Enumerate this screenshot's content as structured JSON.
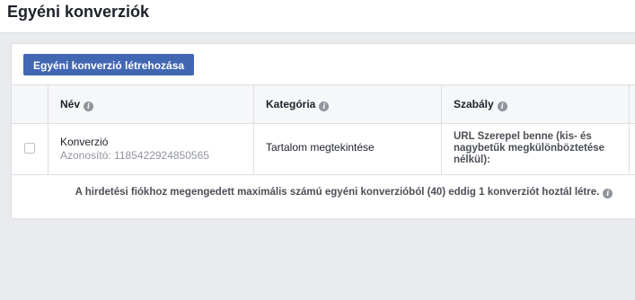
{
  "page": {
    "title": "Egyéni konverziók"
  },
  "toolbar": {
    "create_label": "Egyéni konverzió létrehozása"
  },
  "table": {
    "columns": [
      {
        "label": "Név",
        "info_icon": "info-icon"
      },
      {
        "label": "Kategória",
        "info_icon": "info-icon"
      },
      {
        "label": "Szabály",
        "info_icon": "info-icon"
      }
    ],
    "rows": [
      {
        "name": "Konverzió",
        "id_text": "Azonosító: 1185422924850565",
        "category": "Tartalom megtekintése",
        "rule": "URL Szerepel benne (kis- és nagybetűk megkülönböztetése nélkül):"
      }
    ]
  },
  "footer": {
    "limit_text": "A hirdetési fiókhoz megengedett maximális számú egyéni konverzióból (40) eddig 1 konverziót hoztál létre."
  },
  "colors": {
    "accent": "#4267b2",
    "background": "#e9ebee"
  }
}
